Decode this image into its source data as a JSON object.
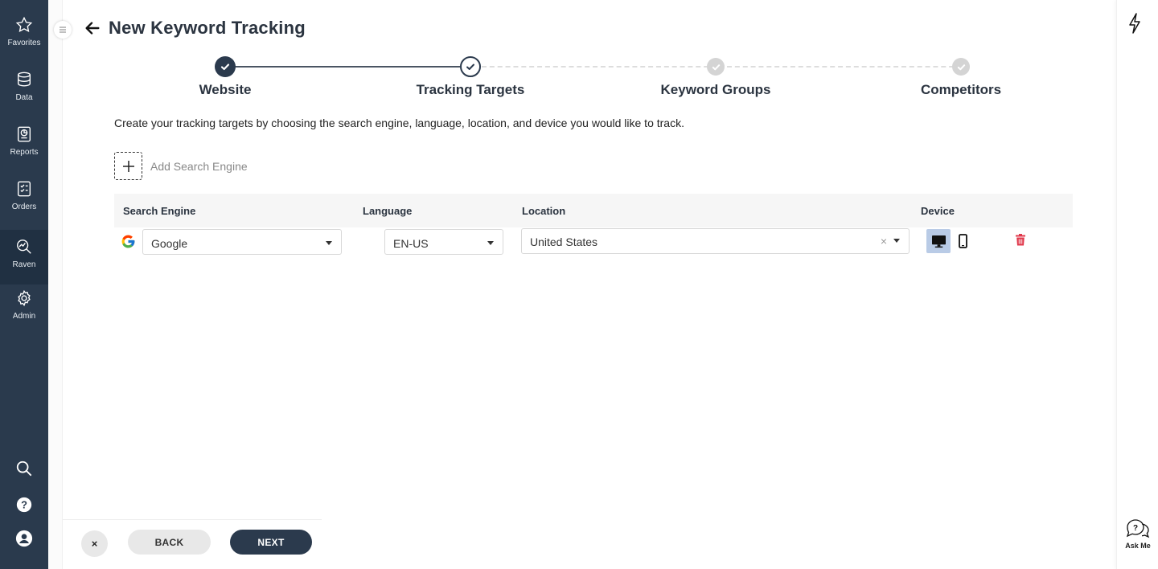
{
  "nav": {
    "items": [
      {
        "label": "Favorites",
        "icon": "star-icon"
      },
      {
        "label": "Data",
        "icon": "database-icon"
      },
      {
        "label": "Reports",
        "icon": "report-icon"
      },
      {
        "label": "Orders",
        "icon": "orders-icon"
      },
      {
        "label": "Raven",
        "icon": "raven-icon"
      },
      {
        "label": "Admin",
        "icon": "gear-icon"
      }
    ],
    "active": "Raven"
  },
  "header": {
    "title": "New Keyword Tracking"
  },
  "stepper": {
    "steps": [
      {
        "label": "Website",
        "state": "done"
      },
      {
        "label": "Tracking Targets",
        "state": "current"
      },
      {
        "label": "Keyword Groups",
        "state": "todo"
      },
      {
        "label": "Competitors",
        "state": "todo"
      }
    ]
  },
  "intro": "Create your tracking targets by choosing the search engine, language, location, and device you would like to track.",
  "add_engine": {
    "label": "Add Search Engine"
  },
  "table": {
    "headers": {
      "engine": "Search Engine",
      "language": "Language",
      "location": "Location",
      "device": "Device"
    },
    "row": {
      "engine": "Google",
      "language": "EN-US",
      "location": "United States",
      "device_selected": "desktop"
    }
  },
  "right_rail": {
    "askme_label": "Ask Me"
  },
  "footer": {
    "close_label": "×",
    "back_label": "BACK",
    "next_label": "NEXT"
  },
  "colors": {
    "nav_bg": "#2a3a4d",
    "primary": "#2b3a4d",
    "device_selected": "#b9cbe6",
    "danger": "#e0384b"
  }
}
